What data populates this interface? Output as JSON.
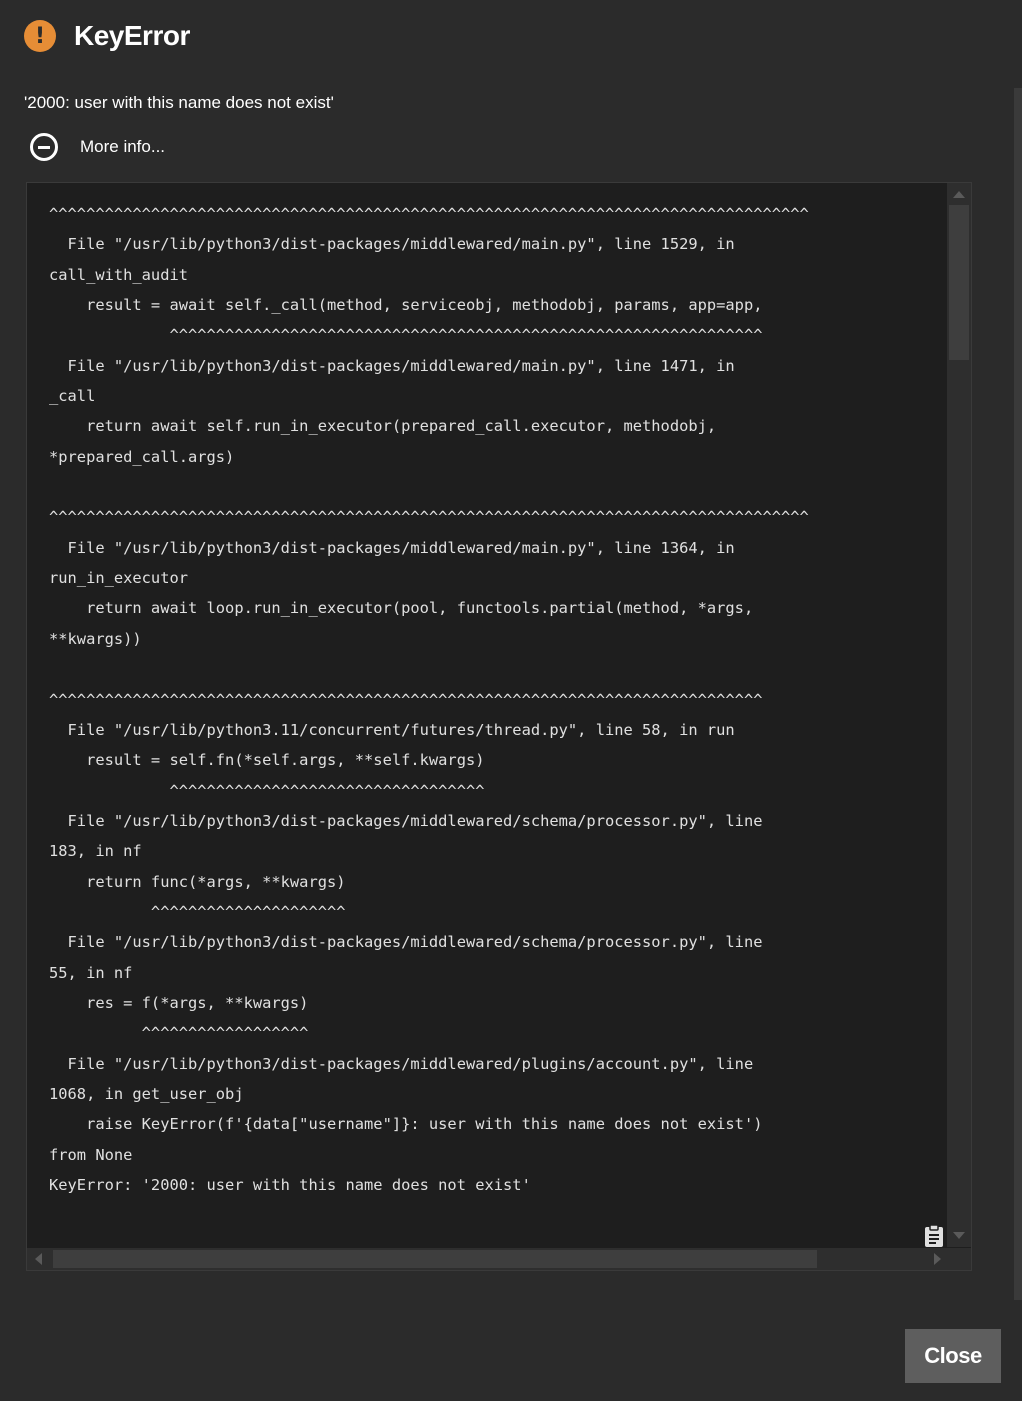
{
  "dialog": {
    "title": "KeyError",
    "message": "'2000: user with this name does not exist'",
    "more_info_label": "More info...",
    "close_label": "Close",
    "accent_color": "#e68d36",
    "warn_glyph": "!"
  },
  "icons": {
    "title": "warning-circle-icon",
    "toggle": "minus-circle-icon",
    "copy": "clipboard-icon"
  },
  "traceback": "^^^^^^^^^^^^^^^^^^^^^^^^^^^^^^^^^^^^^^^^^^^^^^^^^^^^^^^^^^^^^^^^^^^^^^^^^^^^^^^^^^\n  File \"/usr/lib/python3/dist-packages/middlewared/main.py\", line 1529, in\ncall_with_audit\n    result = await self._call(method, serviceobj, methodobj, params, app=app,\n             ^^^^^^^^^^^^^^^^^^^^^^^^^^^^^^^^^^^^^^^^^^^^^^^^^^^^^^^^^^^^^^^^\n  File \"/usr/lib/python3/dist-packages/middlewared/main.py\", line 1471, in\n_call\n    return await self.run_in_executor(prepared_call.executor, methodobj,\n*prepared_call.args)\n\n^^^^^^^^^^^^^^^^^^^^^^^^^^^^^^^^^^^^^^^^^^^^^^^^^^^^^^^^^^^^^^^^^^^^^^^^^^^^^^^^^^\n  File \"/usr/lib/python3/dist-packages/middlewared/main.py\", line 1364, in\nrun_in_executor\n    return await loop.run_in_executor(pool, functools.partial(method, *args,\n**kwargs))\n\n^^^^^^^^^^^^^^^^^^^^^^^^^^^^^^^^^^^^^^^^^^^^^^^^^^^^^^^^^^^^^^^^^^^^^^^^^^^^^\n  File \"/usr/lib/python3.11/concurrent/futures/thread.py\", line 58, in run\n    result = self.fn(*self.args, **self.kwargs)\n             ^^^^^^^^^^^^^^^^^^^^^^^^^^^^^^^^^^\n  File \"/usr/lib/python3/dist-packages/middlewared/schema/processor.py\", line\n183, in nf\n    return func(*args, **kwargs)\n           ^^^^^^^^^^^^^^^^^^^^^\n  File \"/usr/lib/python3/dist-packages/middlewared/schema/processor.py\", line\n55, in nf\n    res = f(*args, **kwargs)\n          ^^^^^^^^^^^^^^^^^^\n  File \"/usr/lib/python3/dist-packages/middlewared/plugins/account.py\", line\n1068, in get_user_obj\n    raise KeyError(f'{data[\"username\"]}: user with this name does not exist')\nfrom None\nKeyError: '2000: user with this name does not exist'"
}
